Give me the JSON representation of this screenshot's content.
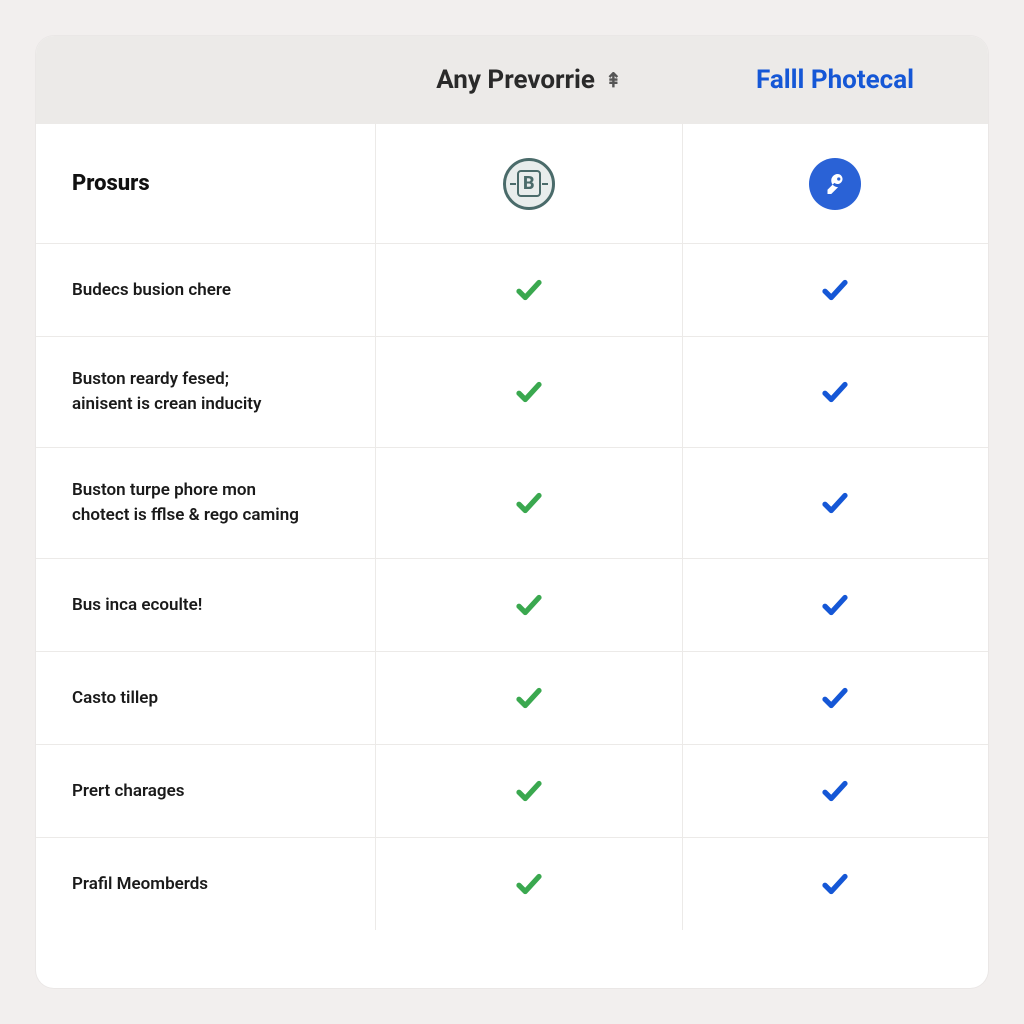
{
  "plans": {
    "a": {
      "title": "Any Prevorrie",
      "glyph": "⇞",
      "icon_name": "bank-badge-icon"
    },
    "b": {
      "title": "Falll Photecal",
      "icon_name": "key-badge-icon"
    }
  },
  "section_label": "Prosurs",
  "features": [
    {
      "label": "Budecs busion chere",
      "a": true,
      "b": true
    },
    {
      "label": "Buston reardy fesed;\nainisent is crean inducity",
      "a": true,
      "b": true
    },
    {
      "label": "Buston turpe phore mon\nchotect is fflse & rego caming",
      "a": true,
      "b": true
    },
    {
      "label": "Bus inca ecoulte!",
      "a": true,
      "b": true
    },
    {
      "label": "Casto tillep",
      "a": true,
      "b": true
    },
    {
      "label": "Prert charages",
      "a": true,
      "b": true
    },
    {
      "label": "Prafil Meomberds",
      "a": true,
      "b": true
    }
  ],
  "colors": {
    "check_a": "#3aa84f",
    "check_b": "#1557d6",
    "accent_b": "#1557d6"
  }
}
